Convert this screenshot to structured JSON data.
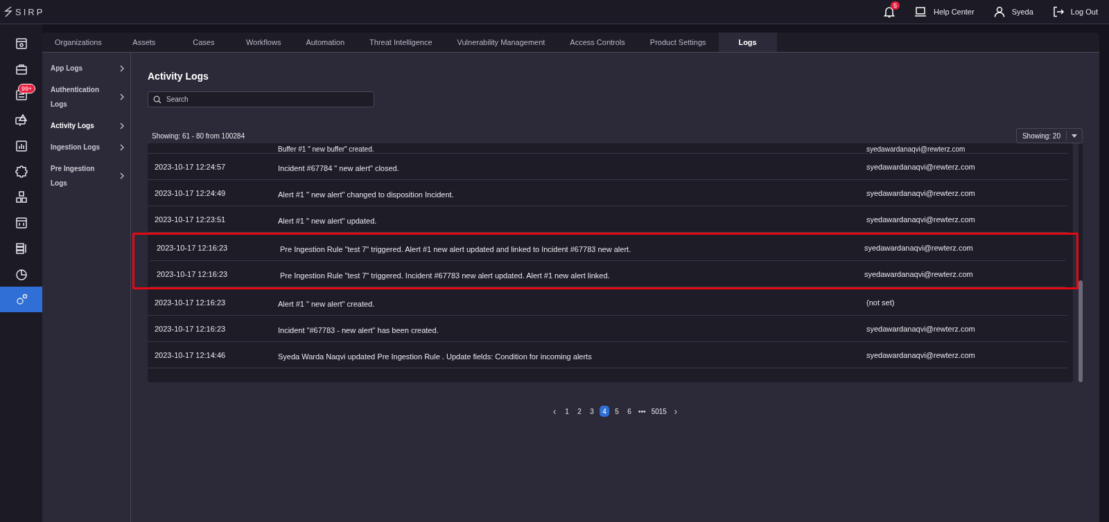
{
  "topbar": {
    "logo": "SIRP",
    "notifications": {
      "count": "5"
    },
    "help": "Help Center",
    "user": "Syeda",
    "logout": "Log Out"
  },
  "rail": [
    {
      "selected": false
    },
    {
      "selected": false
    },
    {
      "selected": false,
      "badge": "99+"
    },
    {
      "selected": false
    },
    {
      "selected": false
    },
    {
      "selected": false
    },
    {
      "selected": false
    },
    {
      "selected": false
    },
    {
      "selected": false
    },
    {
      "selected": false
    },
    {
      "selected": true
    }
  ],
  "tabs": [
    {
      "label": "Organizations",
      "selected": false
    },
    {
      "label": "Assets",
      "selected": false
    },
    {
      "label": "Cases",
      "selected": false
    },
    {
      "label": "Workflows",
      "selected": false
    },
    {
      "label": "Automation",
      "selected": false
    },
    {
      "label": "Threat Intelligence",
      "selected": false
    },
    {
      "label": "Vulnerability Management",
      "selected": false
    },
    {
      "label": "Access Controls",
      "selected": false
    },
    {
      "label": "Product Settings",
      "selected": false
    },
    {
      "label": "Logs",
      "selected": true
    }
  ],
  "subnav": [
    {
      "label": "App Logs",
      "selected": false
    },
    {
      "label": "Authentication Logs",
      "selected": false
    },
    {
      "label": "Activity Logs",
      "selected": true
    },
    {
      "label": "Ingestion Logs",
      "selected": false
    },
    {
      "label": "Pre Ingestion Logs",
      "selected": false
    }
  ],
  "page": {
    "title": "Activity Logs",
    "search": {
      "placeholder": "Search"
    },
    "summary": "Showing: 61 - 80 from 100284",
    "page_size": "Showing: 20"
  },
  "table": {
    "rows": [
      {
        "time": "",
        "message": "Buffer #1 \" new buffer\" created.",
        "user": "syedawardanaqvi@rewterz.com",
        "highlighted": false
      },
      {
        "time": "2023-10-17 12:24:57",
        "message": "Incident #67784 \" new alert\" closed.",
        "user": "syedawardanaqvi@rewterz.com",
        "highlighted": false
      },
      {
        "time": "2023-10-17 12:24:49",
        "message": "Alert #1 \" new alert\" changed to disposition Incident.",
        "user": "syedawardanaqvi@rewterz.com",
        "highlighted": false
      },
      {
        "time": "2023-10-17 12:23:51",
        "message": "Alert #1 \" new alert\" updated.",
        "user": "syedawardanaqvi@rewterz.com",
        "highlighted": false
      },
      {
        "time": "2023-10-17 12:16:23",
        "message": "Pre Ingestion Rule \"test 7\" triggered. Alert #1 new alert updated and linked to Incident #67783 new alert.",
        "user": "syedawardanaqvi@rewterz.com",
        "highlighted": true
      },
      {
        "time": "2023-10-17 12:16:23",
        "message": "Pre Ingestion Rule \"test 7\" triggered. Incident #67783 new alert updated. Alert #1 new alert linked.",
        "user": "syedawardanaqvi@rewterz.com",
        "highlighted": true
      },
      {
        "time": "2023-10-17 12:16:23",
        "message": "Alert #1 \" new alert\" created.",
        "user": "(not set)",
        "highlighted": false
      },
      {
        "time": "2023-10-17 12:16:23",
        "message": "Incident \"#67783 - new alert\" has been created.",
        "user": "syedawardanaqvi@rewterz.com",
        "highlighted": false
      },
      {
        "time": "2023-10-17 12:14:46",
        "message": "Syeda Warda Naqvi updated Pre Ingestion Rule . Update fields: Condition for incoming alerts",
        "user": "syedawardanaqvi@rewterz.com",
        "highlighted": false
      }
    ]
  },
  "pagination": {
    "prev": "‹",
    "next": "›",
    "pages": [
      {
        "label": "1",
        "selected": false
      },
      {
        "label": "2",
        "selected": false
      },
      {
        "label": "3",
        "selected": false
      },
      {
        "label": "4",
        "selected": true
      },
      {
        "label": "5",
        "selected": false
      },
      {
        "label": "6",
        "selected": false
      },
      {
        "label": "•••",
        "selected": false
      },
      {
        "label": "5015",
        "selected": false
      }
    ]
  }
}
